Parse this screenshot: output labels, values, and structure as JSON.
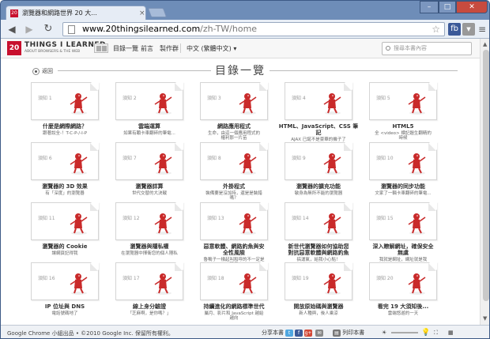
{
  "browser": {
    "tab_title": "瀏覽器和網路世界 20 大...",
    "tab_close": "×",
    "url_host": "www.20thingsilearned.com",
    "url_path": "/zh-TW/home",
    "back": "◀",
    "forward": "▶",
    "reload": "↻",
    "star": "☆",
    "win_min": "–",
    "win_max": "□",
    "win_close": "✕",
    "ext_fb": "fb",
    "ext_shield": "▼",
    "menu": "≡",
    "logo_glyph": "20"
  },
  "site": {
    "logo": "20",
    "brand": "THINGS I LEARNED",
    "brand_sub": "ABOUT BROWSERS & THE WEB",
    "nav": [
      "目錄一覽",
      "前言",
      "製作群"
    ],
    "language": "中文 (繁體中文)",
    "language_arrow": "▾",
    "search_placeholder": "搜尋本書內容",
    "back_label": "返回",
    "page_title": "目錄一覽"
  },
  "cards": [
    {
      "label": "須知 1",
      "title": "什麼是網際網路？",
      "sub": "跟著說全-！T-C-P-/-I-P"
    },
    {
      "label": "須知 2",
      "title": "雲端運算",
      "sub": "如果有顆卡車翻碎的筆電..."
    },
    {
      "label": "須知 3",
      "title": "網路應用程式",
      "sub": "生命，由這一個應用程式的\n權利那一片苗"
    },
    {
      "label": "須知 4",
      "title": "HTML、JavaScript、CSS 筆\n記",
      "sub": "AJAX 已誕不是豪華的機子了"
    },
    {
      "label": "須知 5",
      "title": "HTML5",
      "sub": "全 <video> 標記題生翻精的\n時候"
    },
    {
      "label": "須知 6",
      "title": "瀏覽器的 3D 效果",
      "sub": "有「深度」的瀏覽器"
    },
    {
      "label": "須知 7",
      "title": "瀏覽器詳算",
      "sub": "世代交替的大決戰"
    },
    {
      "label": "須知 8",
      "title": "外掛程式",
      "sub": "裝備要是沒加持，還是是裝錯\n嗎？"
    },
    {
      "label": "須知 9",
      "title": "瀏覽器的擴充功能",
      "sub": "敏身為無所不能的瀏覽器"
    },
    {
      "label": "須知 10",
      "title": "瀏覽器的同步功能",
      "sub": "文家了一輛卡車翻碎的筆電..."
    },
    {
      "label": "須知 11",
      "title": "瀏覽器的 Cookie",
      "sub": "讓網頁記得我"
    },
    {
      "label": "須知 12",
      "title": "瀏覽器與隱私權",
      "sub": "在瀏覽器中揮衛您的個人隱私"
    },
    {
      "label": "須知 13",
      "title": "惡意軟體、網路釣魚與安\n全性風險",
      "sub": "魯鴨子一樣起叫和呼的不一定是\n鴨子"
    },
    {
      "label": "須知 14",
      "title": "新世代瀏覽器如何協助您\n對抗惡意軟體與網路釣魚",
      "sub": "搞運氣，給我小心點！"
    },
    {
      "label": "須知 15",
      "title": "深入瞭解網址，確保安全\n無虞",
      "sub": "我就是網址，網址就是我"
    },
    {
      "label": "須知 16",
      "title": "IP 位址與 DNS",
      "sub": "電話號碼地了"
    },
    {
      "label": "須知 17",
      "title": "線上身分驗證",
      "sub": "「芝麻啊，是你嗎？」"
    },
    {
      "label": "須知 18",
      "title": "持續進化的網路標準世代",
      "sub": "屬月、影片和 JavaScript 越給\n越向"
    },
    {
      "label": "須知 19",
      "title": "開放原始碼與瀏覽器",
      "sub": "新人種與，後人乘涼"
    },
    {
      "label": "須知 20",
      "title": "看完 19 大須知後...",
      "sub": "雲端悠遊的一天"
    }
  ],
  "status": {
    "copyright": "Google Chrome 小組出品 • ©2010 Google Inc. 保留所有權利。",
    "share": "分享本書",
    "gplus": "g+",
    "print": "列印本書"
  },
  "colors": {
    "brand_red": "#c8102e",
    "figure_red": "#c92a2a",
    "titlebar": "#6e8db8"
  }
}
